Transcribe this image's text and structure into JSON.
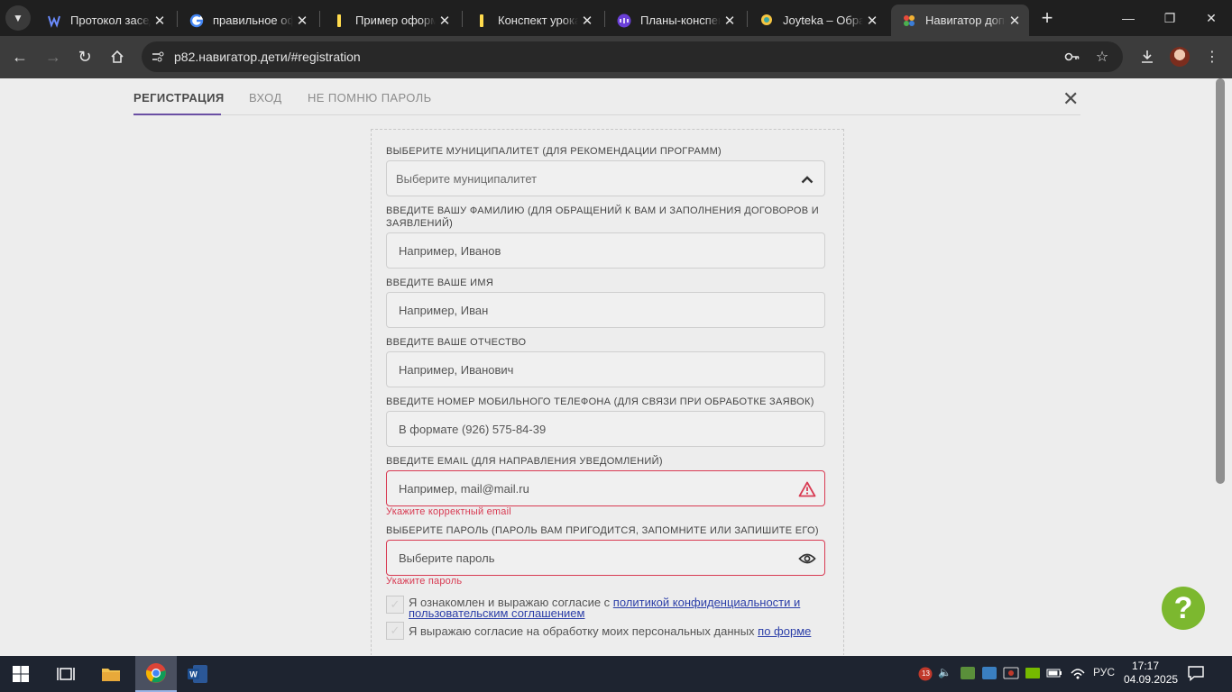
{
  "browser": {
    "tabs": [
      {
        "title": "Протокол засед",
        "icon": "word-like-icon"
      },
      {
        "title": "правильное оф",
        "icon": "google-icon"
      },
      {
        "title": "Пример оформ",
        "icon": "yandex-icon"
      },
      {
        "title": "Конспект урока",
        "icon": "yandex-icon"
      },
      {
        "title": "Планы-конспек",
        "icon": "uchi-icon"
      },
      {
        "title": "Joyteka – Образ",
        "icon": "joyteka-icon"
      },
      {
        "title": "Навигатор допо",
        "icon": "navigator-icon",
        "active": true
      }
    ],
    "url": "р82.навигатор.дети/#registration"
  },
  "page": {
    "tabs": {
      "registration": "Регистрация",
      "login": "Вход",
      "forgot": "Не помню пароль"
    },
    "form": {
      "municipality_label": "Выберите муниципалитет (для рекомендации программ)",
      "municipality_placeholder": "Выберите муниципалитет",
      "surname_label": "Введите вашу фамилию (для обращений к вам и заполнения договоров и заявлений)",
      "surname_placeholder": "Например, Иванов",
      "name_label": "Введите ваше имя",
      "name_placeholder": "Например, Иван",
      "patronymic_label": "Введите ваше отчество",
      "patronymic_placeholder": "Например, Иванович",
      "phone_label": "Введите номер мобильного телефона (для связи при обработке заявок)",
      "phone_placeholder": "В формате (926) 575-84-39",
      "email_label": "Введите email (для направления уведомлений)",
      "email_placeholder": "Например, mail@mail.ru",
      "email_error": "Укажите корректный email",
      "password_label": "Выберите пароль (пароль вам пригодится, запомните или запишите его)",
      "password_placeholder": "Выберите пароль",
      "password_error": "Укажите пароль",
      "consent1_text": "Я ознакомлен и выражаю согласие с ",
      "consent1_link": "политикой конфиденциальности и пользовательским соглашением",
      "consent2_text": "Я выражаю согласие на обработку моих персональных данных ",
      "consent2_link": "по форме"
    },
    "help_label": "?"
  },
  "taskbar": {
    "lang": "РУС",
    "time": "17:17",
    "date": "04.09.2025",
    "badge": "13"
  },
  "colors": {
    "accent": "#6a4fa3",
    "error": "#d83a52",
    "link": "#2b3ea8",
    "help": "#7cb82f"
  }
}
